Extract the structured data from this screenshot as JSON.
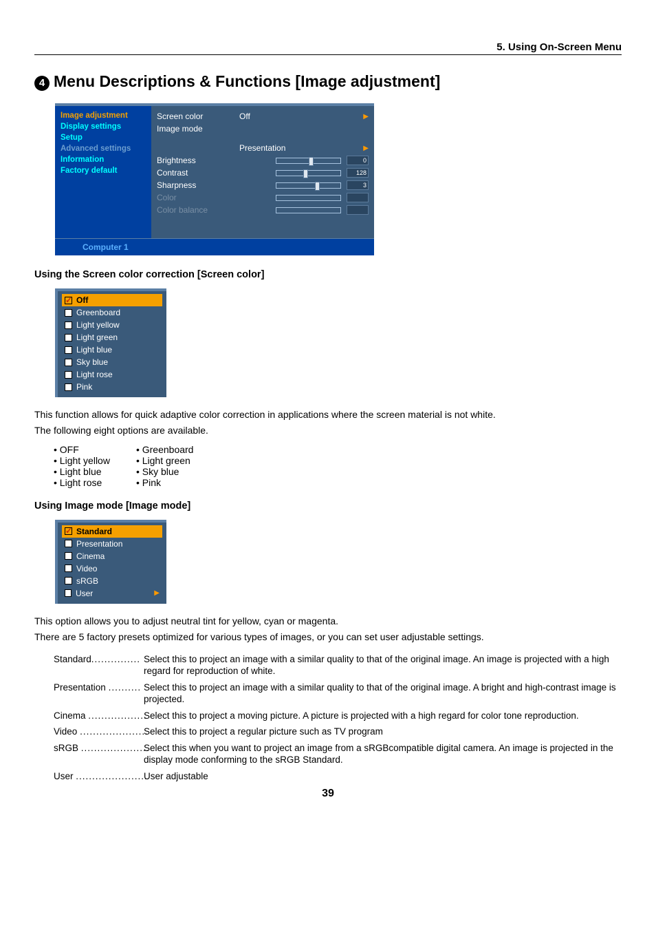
{
  "chapter": "5. Using On-Screen Menu",
  "section": {
    "number": "4",
    "title": "Menu Descriptions & Functions [Image adjustment]"
  },
  "osd": {
    "sidebar": [
      {
        "label": "Image adjustment",
        "active": true
      },
      {
        "label": "Display settings"
      },
      {
        "label": "Setup"
      },
      {
        "label": "Advanced settings",
        "dim": true
      },
      {
        "label": "Information"
      },
      {
        "label": "Factory default"
      }
    ],
    "rows": {
      "screen_color": {
        "label": "Screen color",
        "value": "Off"
      },
      "image_mode": {
        "label": "Image mode",
        "value": "Presentation"
      },
      "brightness": {
        "label": "Brightness",
        "num": "0",
        "pos": 50
      },
      "contrast": {
        "label": "Contrast",
        "num": "128",
        "pos": 42
      },
      "sharpness": {
        "label": "Sharpness",
        "num": "3",
        "pos": 60
      },
      "color": {
        "label": "Color"
      },
      "color_balance": {
        "label": "Color balance"
      }
    },
    "footer": "Computer 1"
  },
  "screen_color_section": {
    "heading": "Using the Screen color correction [Screen color]",
    "popup": [
      {
        "label": "Off",
        "selected": true
      },
      {
        "label": "Greenboard"
      },
      {
        "label": "Light yellow"
      },
      {
        "label": "Light green"
      },
      {
        "label": "Light blue"
      },
      {
        "label": "Sky blue"
      },
      {
        "label": "Light rose"
      },
      {
        "label": "Pink"
      }
    ],
    "desc1": "This function allows for quick adaptive color correction in applications where the screen material is not white.",
    "desc2": "The following eight options are available.",
    "col1": [
      "OFF",
      "Light yellow",
      "Light blue",
      "Light rose"
    ],
    "col2": [
      "Greenboard",
      "Light green",
      "Sky blue",
      "Pink"
    ]
  },
  "image_mode_section": {
    "heading": "Using Image mode [Image mode]",
    "popup": [
      {
        "label": "Standard",
        "selected": true
      },
      {
        "label": "Presentation"
      },
      {
        "label": "Cinema"
      },
      {
        "label": "Video"
      },
      {
        "label": "sRGB"
      },
      {
        "label": "User",
        "submenu": true
      }
    ],
    "desc1": "This option allows you to adjust neutral tint for yellow, cyan or magenta.",
    "desc2": "There are 5 factory presets optimized for various types of images, or you can set user adjustable settings.",
    "definitions": [
      {
        "term": "Standard",
        "dots": "...............",
        "desc": "Select this to project an image with a similar quality to that of the original image. An image is projected with a high regard for reproduction of white."
      },
      {
        "term": "Presentation",
        "dots": "..........",
        "desc": "Select this to project an image with a similar quality to that of the original image. A bright and high-contrast image is projected."
      },
      {
        "term": "Cinema",
        "dots": "..................",
        "desc": "Select this to project a moving picture. A picture is projected with a high regard for color tone reproduction."
      },
      {
        "term": "Video",
        "dots": ".....................",
        "desc": "Select this to project a regular picture such as TV program"
      },
      {
        "term": "sRGB",
        "dots": ".....................",
        "desc": "Select this when you want to project an image from a sRGBcompatible digital camera. An image is projected in the display mode conforming to the sRGB Standard."
      },
      {
        "term": "User",
        "dots": "......................",
        "desc": "User adjustable"
      }
    ]
  },
  "page_number": "39"
}
